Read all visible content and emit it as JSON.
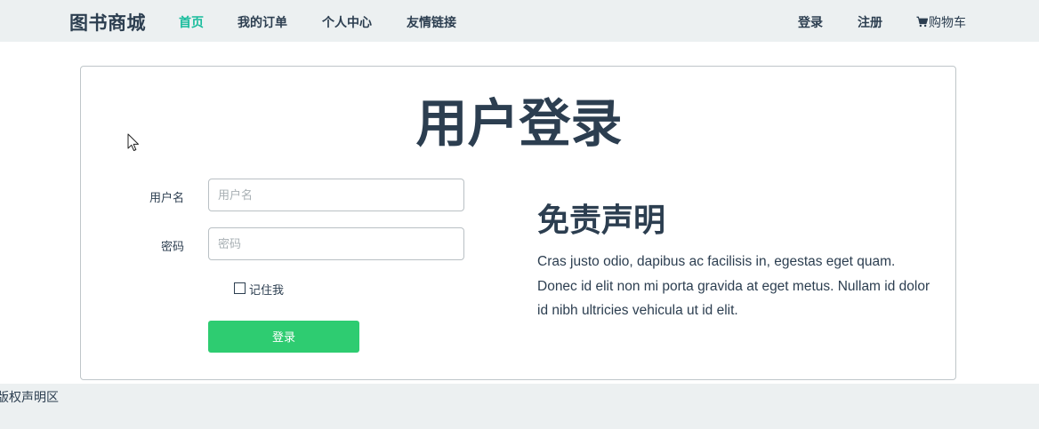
{
  "navbar": {
    "brand": "图书商城",
    "links": {
      "home": "首页",
      "orders": "我的订单",
      "profile": "个人中心",
      "friends": "友情链接"
    },
    "login": "登录",
    "register": "注册",
    "cart": "购物车",
    "cart_icon": "shopping-cart-icon",
    "active_color": "#18bc9c"
  },
  "login_form": {
    "title": "用户登录",
    "username_label": "用户名",
    "username_placeholder": "用户名",
    "username_value": "",
    "password_label": "密码",
    "password_placeholder": "密码",
    "password_value": "",
    "remember_label": "记住我",
    "remember_checked": false,
    "submit_label": "登录",
    "submit_color": "#2ecc71"
  },
  "disclaimer": {
    "title": "免责声明",
    "text": "Cras justo odio, dapibus ac facilisis in, egestas eget quam. Donec id elit non mi porta gravida at eget metus. Nullam id dolor id nibh ultricies vehicula ut id elit."
  },
  "footer": {
    "text": "版权声明区"
  },
  "colors": {
    "primary_text": "#2c3e50",
    "navbar_bg": "#ecf0f1"
  }
}
